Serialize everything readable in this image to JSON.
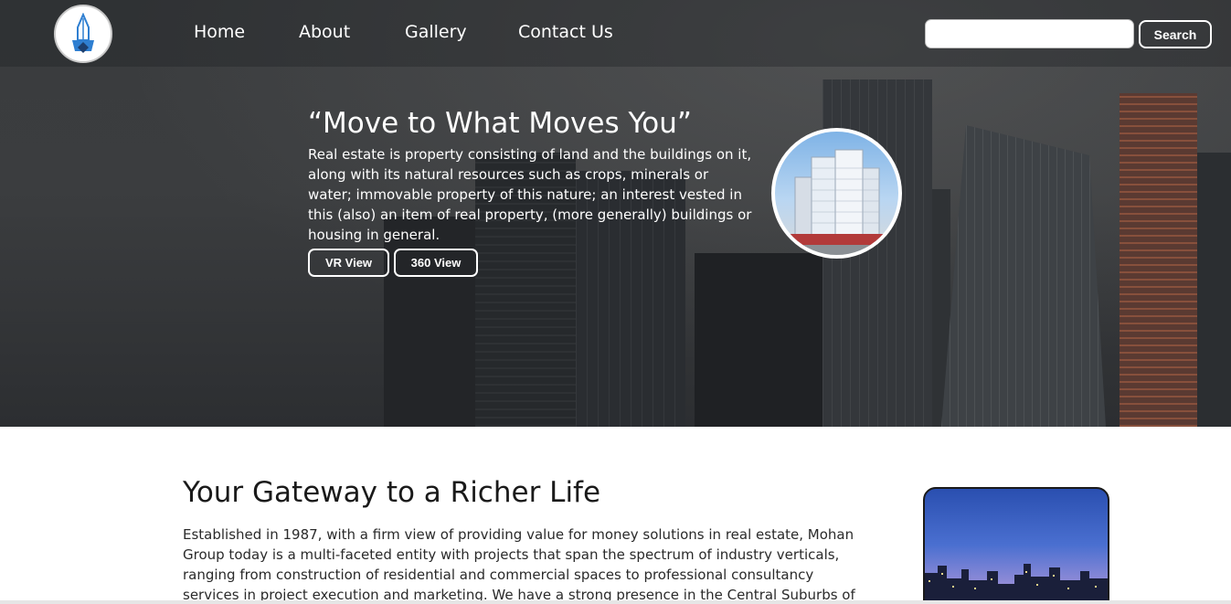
{
  "nav": {
    "links": [
      "Home",
      "About",
      "Gallery",
      "Contact Us"
    ],
    "search_placeholder": "",
    "search_button": "Search"
  },
  "hero": {
    "title": "“Move to What Moves You”",
    "text": "Real estate is property consisting of land and the buildings on it, along with its natural resources such as crops, minerals or water; immovable property of this nature; an interest vested in this (also) an item of real property, (more generally) buildings or housing in general.",
    "buttons": [
      "VR View",
      "360 View"
    ]
  },
  "about": {
    "title": "Your Gateway to a Richer Life",
    "text": "Established in 1987, with a firm view of providing value for money solutions in real estate, Mohan Group today is a multi-faceted entity with projects that span the spectrum of industry verticals, ranging from construction of residential and commercial spaces to professional consultancy services in project execution and marketing. We have a strong presence in the Central Suburbs of"
  },
  "icons": {
    "logo": "building-logo-icon",
    "hero_photo": "tower-photo",
    "about_photo": "city-skyline-photo"
  },
  "colors": {
    "logo_blue": "#2f7fd1",
    "text_dark": "#1a1a1a"
  }
}
